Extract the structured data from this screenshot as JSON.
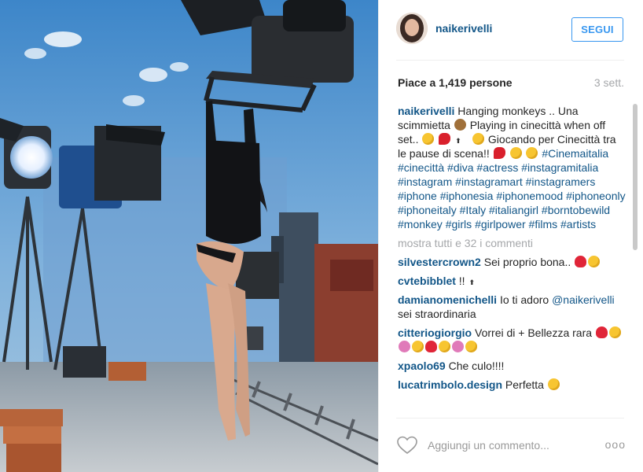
{
  "post": {
    "username": "naikerivelli",
    "follow_label": "SEGUI",
    "likes": "Piace a 1,419 persone",
    "age": "3 sett."
  },
  "caption": {
    "user": "naikerivelli",
    "t1": "Hanging monkeys .. Una scimmietta",
    "t2": "Playing in cinecittà when off set..",
    "t3": "Giocando per Cinecittà tra le pause di scena!!",
    "hashtags": [
      "#Cinemaitalia",
      "#cinecittà",
      "#diva",
      "#actress",
      "#instagramitalia",
      "#instagram",
      "#instagramart",
      "#instagramers",
      "#iphone",
      "#iphonesia",
      "#iphonemood",
      "#iphoneonly",
      "#iphoneitaly",
      "#Italy",
      "#italiangirl",
      "#borntobewild",
      "#monkey",
      "#girls",
      "#girlpower",
      "#films",
      "#artists"
    ]
  },
  "show_all": "mostra tutti e 32 i commenti",
  "comments": [
    {
      "user": "silvestercrown2",
      "text": "Sei proprio bona.."
    },
    {
      "user": "cvtebibblet",
      "text": "!!"
    },
    {
      "user": "damianomenichelli",
      "text": "Io ti adoro",
      "mention": "@naikerivelli",
      "text2": "sei straordinaria"
    },
    {
      "user": "citteriogiorgio",
      "text": "Vorrei di + Bellezza rara"
    },
    {
      "user": "xpaolo69",
      "text": "Che culo!!!!"
    },
    {
      "user": "lucatrimbolo.design",
      "text": "Perfetta"
    }
  ],
  "add_comment_placeholder": "Aggiungi un commento...",
  "more_options": "ooo",
  "icons": {
    "follow": "follow-button",
    "heart": "heart-outline-icon",
    "more": "more-options-icon"
  },
  "colors": {
    "username": "#125688",
    "follow": "#3897f0",
    "muted": "#a5a7aa"
  }
}
